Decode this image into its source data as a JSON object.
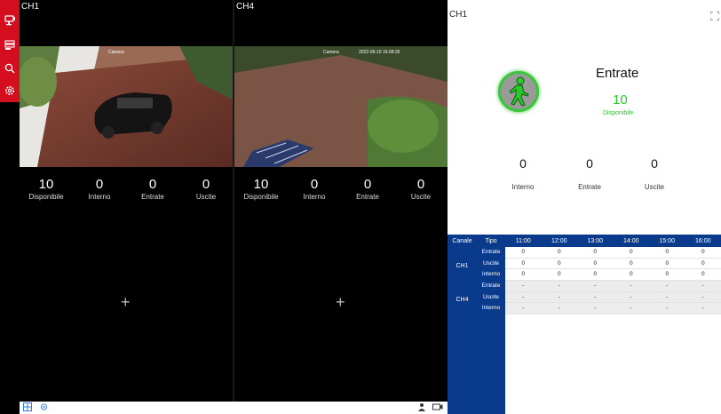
{
  "sidebar": {
    "icons": [
      "camera-icon",
      "playback-icon",
      "search-icon",
      "settings-icon"
    ]
  },
  "grid": {
    "tiles": [
      {
        "label": "CH1",
        "disponibile": "10",
        "interno": "0",
        "entrate": "0",
        "uscite": "0"
      },
      {
        "label": "CH4",
        "disponibile": "10",
        "interno": "0",
        "entrate": "0",
        "uscite": "0"
      }
    ],
    "stat_labels": {
      "disponibile": "Disponibile",
      "interno": "Interno",
      "entrate": "Entrate",
      "uscite": "Uscite"
    },
    "cam1_overlay": "Camera",
    "cam4_overlay": "Camera",
    "cam4_time": "2022-06-10 16:08:35",
    "add_symbol": "+"
  },
  "panel": {
    "title": "CH1",
    "heading": "Entrate",
    "available_value": "10",
    "available_label": "Disponibile",
    "interno_value": "0",
    "entrate_value": "0",
    "uscite_value": "0",
    "interno_label": "Interno",
    "entrate_label": "Entrate",
    "uscite_label": "Uscite",
    "accent_color": "#2bc82b",
    "table_header_color": "#0a3a8c"
  },
  "table": {
    "col_canale": "Canale",
    "col_tipo": "Tipo",
    "hours": [
      "11:00",
      "12:00",
      "13:00",
      "14:00",
      "15:00",
      "16:00"
    ],
    "channels": [
      {
        "name": "CH1",
        "rows": [
          {
            "tipo": "Entrate",
            "values": [
              "0",
              "0",
              "0",
              "0",
              "0",
              "0"
            ]
          },
          {
            "tipo": "Uscite",
            "values": [
              "0",
              "0",
              "0",
              "0",
              "0",
              "0"
            ]
          },
          {
            "tipo": "Interno",
            "values": [
              "0",
              "0",
              "0",
              "0",
              "0",
              "0"
            ]
          }
        ]
      },
      {
        "name": "CH4",
        "rows": [
          {
            "tipo": "Entrate",
            "values": [
              "-",
              "-",
              "-",
              "-",
              "-",
              "-"
            ]
          },
          {
            "tipo": "Uscite",
            "values": [
              "-",
              "-",
              "-",
              "-",
              "-",
              "-"
            ]
          },
          {
            "tipo": "Interno",
            "values": [
              "-",
              "-",
              "-",
              "-",
              "-",
              "-"
            ]
          }
        ]
      }
    ]
  }
}
